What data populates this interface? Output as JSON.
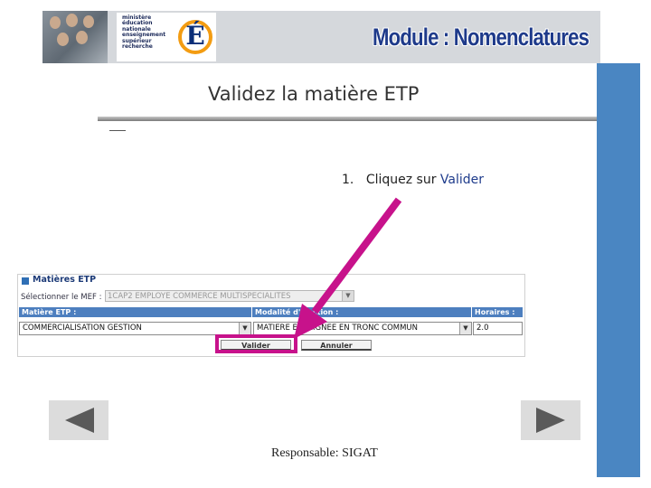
{
  "header": {
    "ministry_lines": [
      "ministère",
      "éducation",
      "nationale",
      "enseignement",
      "supérieur",
      "recherche"
    ],
    "ministry_logo_letter": "É",
    "module_title": "Module : Nomenclatures"
  },
  "slide": {
    "title": "Validez la matière ETP",
    "instruction_number": "1.",
    "instruction_prefix": "Cliquez sur",
    "instruction_link": "Valider",
    "footer": "Responsable: SIGAT"
  },
  "form": {
    "panel_title": "Matières ETP",
    "mef_label": "Sélectionner le MEF :",
    "mef_value": "1CAP2 EMPLOYE COMMERCE MULTISPECIALITES",
    "col_matiere": "Matière ETP :",
    "col_modalite": "Modalité d'élection :",
    "col_horaires": "Horaires :",
    "matiere_value": "COMMERCIALISATION GESTION",
    "modalite_value": "MATIERE ENSEIGNEE EN TRONC COMMUN",
    "horaire_value": "2.0",
    "valider_label": "Valider",
    "annuler_label": "Annuler"
  },
  "colors": {
    "accent_blue": "#4a86c2",
    "highlight_magenta": "#c7128b"
  },
  "icons": {
    "prev": "triangle-left-icon",
    "next": "triangle-right-icon",
    "arrow": "pointer-arrow-icon"
  }
}
